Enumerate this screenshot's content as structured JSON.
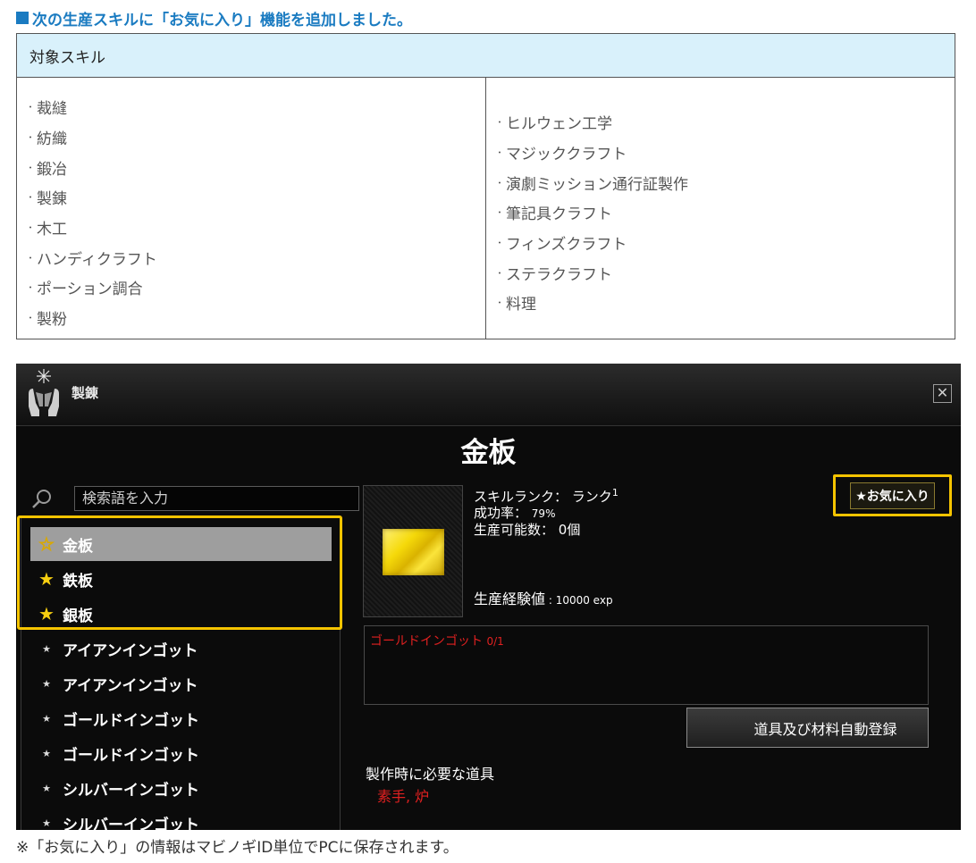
{
  "announcement": {
    "heading": "次の生産スキルに「お気に入り」機能を追加しました。",
    "table_header": "対象スキル",
    "left_skills": [
      "裁縫",
      "紡織",
      "鍛冶",
      "製錬",
      "木工",
      "ハンディクラフト",
      "ポーション調合",
      "製粉"
    ],
    "right_skills": [
      "ヒルウェン工学",
      "マジッククラフト",
      "演劇ミッション通行証製作",
      "筆記具クラフト",
      "フィンズクラフト",
      "ステラクラフト",
      "料理"
    ],
    "footnote": "※「お気に入り」の情報はマビノギID単位でPCに保存されます。"
  },
  "window": {
    "title": "製錬",
    "close_icon": "close-icon",
    "item_title": "金板",
    "search_placeholder": "検索語を入力",
    "list": [
      {
        "label": "金板",
        "icon": "star-outline-icon",
        "selected": true
      },
      {
        "label": "鉄板",
        "icon": "star-filled-icon"
      },
      {
        "label": "銀板",
        "icon": "star-filled-icon"
      },
      {
        "label": "アイアンインゴット",
        "icon": "star-small-icon"
      },
      {
        "label": "アイアンインゴット",
        "icon": "star-small-icon"
      },
      {
        "label": "ゴールドインゴット",
        "icon": "star-small-icon"
      },
      {
        "label": "ゴールドインゴット",
        "icon": "star-small-icon"
      },
      {
        "label": "シルバーインゴット",
        "icon": "star-small-icon"
      },
      {
        "label": "シルバーインゴット",
        "icon": "star-small-icon"
      }
    ],
    "stats": {
      "skill_rank_label": "スキルランク：",
      "skill_rank_value": "ランク",
      "skill_rank_num": "1",
      "success_label": "成功率：",
      "success_value": "79%",
      "producible_label": "生産可能数：",
      "producible_value": "0個",
      "exp_label": "生産経験値",
      "exp_value": "10000 exp"
    },
    "favorite_button": "★お気に入り",
    "material_name": "ゴールドインゴット",
    "material_count": "0/1",
    "auto_register_button": "道具及び材料自動登録",
    "tools_label": "製作時に必要な道具",
    "tools_value": "素手, 炉",
    "colors": {
      "favorite_highlight": "#f5c400",
      "material_text": "#e02020",
      "heading_blue": "#1a7bc1"
    }
  }
}
